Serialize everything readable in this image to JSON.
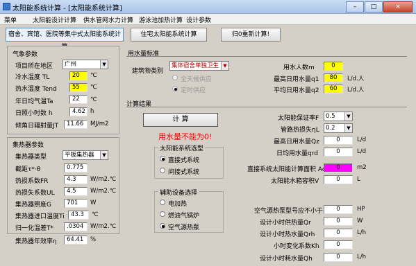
{
  "window": {
    "title": "太阳能系统计算 - [太阳能系统计算]",
    "min": "–",
    "max": "□",
    "close": "×"
  },
  "menu": [
    "菜单",
    "太阳能设计计算",
    "供水管网水力计算",
    "游泳池加热计算",
    "设计参数"
  ],
  "tabs": [
    "宿舍、宾馆、医院等集中式太阳能系统计算",
    "住宅太阳能系统计算",
    "归0重新计算!"
  ],
  "weather": {
    "title": "气象参数",
    "rows": [
      {
        "label": "项目所在地区",
        "value": "广州",
        "unit": ""
      },
      {
        "label": "冷水温度  TL",
        "value": "20",
        "unit": "℃"
      },
      {
        "label": "热水温度 Tend",
        "value": "55",
        "unit": "℃"
      },
      {
        "label": "年日均气温Ta",
        "value": "22",
        "unit": "℃"
      },
      {
        "label": "日照小时数 h",
        "value": "4.62",
        "unit": "h"
      },
      {
        "label": "倾角日辐射量JT",
        "value": "11.66",
        "unit": "MJ/m2"
      }
    ]
  },
  "collector": {
    "title": "集热器参数",
    "rows": [
      {
        "label": "集热器类型",
        "value": "平板集热器",
        "unit": ""
      },
      {
        "label": "截距τ*·θ",
        "value": "0.775",
        "unit": ""
      },
      {
        "label": "热损系数FR",
        "value": "4.3",
        "unit": "W/m2.℃"
      },
      {
        "label": "热损失系数UL",
        "value": "4.5",
        "unit": "W/m2.℃"
      },
      {
        "label": "集热器照度G",
        "value": "701",
        "unit": "W"
      },
      {
        "label": "集热器进口温度Ti",
        "value": "43.3",
        "unit": "℃"
      },
      {
        "label": "归一化温差T*",
        "value": ".0304",
        "unit": "W/m2.℃"
      },
      {
        "label": "集热器年效率η",
        "value": "64.41",
        "unit": "%"
      }
    ]
  },
  "water_std": {
    "title": "用水量标准",
    "building_label": "建筑物类别",
    "building_value": "集体宿舍单独卫生",
    "supply_opts": [
      "全天候供应",
      "定时供应"
    ],
    "users_label": "用水人数m",
    "users_value": "0",
    "peak_label": "最高日用水量q1",
    "peak_value": "80",
    "peak_unit": "L/d.人",
    "avg_label": "平均日用水量q2",
    "avg_value": "60",
    "avg_unit": "L/d.人"
  },
  "results": {
    "title": "计算结果",
    "calc_button": "计 算",
    "warning": "用水量不能为0!",
    "sys_group_title": "太阳能系统选型",
    "sys_opts": [
      "直接式系统",
      "间接式系统"
    ],
    "aux_group_title": "辅助设备选择",
    "aux_opts": [
      "电加热",
      "燃油气锅炉",
      "空气源热泵"
    ],
    "guarantee_label": "太阳能保证率F",
    "guarantee_value": "0.5",
    "pipeloss_label": "管路热损失ηL",
    "pipeloss_value": "0.2",
    "max_daily_label": "最高日用水量Qz",
    "max_daily_value": "0",
    "max_daily_unit": "L/d",
    "avg_daily_label": "日均用水量qrd",
    "avg_daily_value": "0",
    "avg_daily_unit": "L/d",
    "area_label": "直接系统太阳能计算面积 Ac",
    "area_value": "0",
    "area_unit": "m2",
    "tank_label": "太阳能水箱容积V",
    "tank_value": "0",
    "tank_unit": "L",
    "hp_label": "空气源热泵型号应不小于",
    "hp_value": "0",
    "hp_unit": "HP",
    "design_hour_label": "设计小时供热量Qr",
    "design_hour_value": "0",
    "design_hour_unit": "W",
    "design_water_label": "设计小时热水量Qrh",
    "design_water_value": "0",
    "design_water_unit": "L/h",
    "hour_coef_label": "小时变化系数Kh",
    "hour_coef_value": "0",
    "design_cons_label": "设计小时耗水量Qh",
    "design_cons_value": "0",
    "design_cons_unit": "L/h"
  },
  "colors": {
    "yellow": "#ffff00",
    "magenta": "#ff00ff",
    "warning": "#ff0000"
  }
}
